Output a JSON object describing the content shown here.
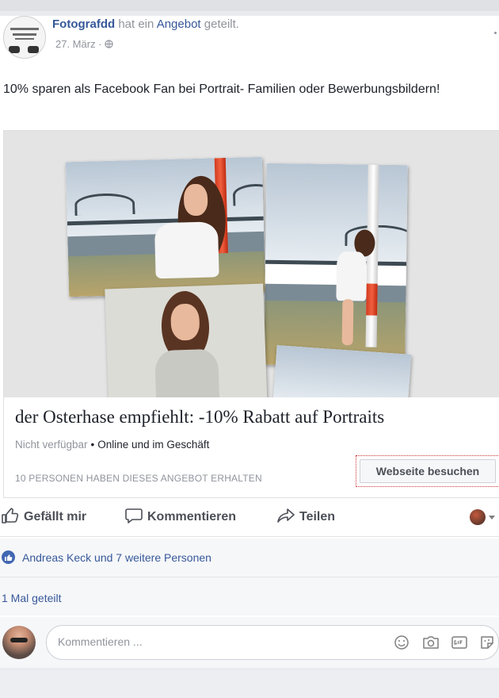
{
  "post": {
    "author": "Fotografdd",
    "verb_pre": " hat ein ",
    "verb_link": "Angebot",
    "verb_post": " geteilt.",
    "date": "27. März",
    "separator": " · ",
    "text": "10% sparen als Facebook Fan bei Portrait- Familien oder Bewerbungsbildern!"
  },
  "offer": {
    "title": "der Osterhase empfiehlt: -10% Rabatt auf Portraits",
    "availability": "Nicht verfügbar",
    "bullet": "•",
    "channel": "Online und im Geschäft",
    "count_text": "10 PERSONEN HABEN DIESES ANGEBOT ERHALTEN",
    "button_label": "Webseite besuchen"
  },
  "actions": {
    "like": "Gefällt mir",
    "comment": "Kommentieren",
    "share": "Teilen"
  },
  "reactions": {
    "text": "Andreas Keck und 7 weitere Personen"
  },
  "shares": {
    "text": "1 Mal geteilt"
  },
  "comment": {
    "placeholder": "Kommentieren ..."
  },
  "colors": {
    "link_blue": "#365899",
    "like_blue": "#4267b2",
    "muted": "#90949c",
    "page_bg": "#e9ebee"
  },
  "icons": [
    "globe-icon",
    "thumbs-up-icon",
    "speech-bubble-icon",
    "share-arrow-icon",
    "like-badge-icon",
    "emoji-icon",
    "camera-icon",
    "gif-icon",
    "sticker-icon",
    "chevron-down-icon"
  ]
}
